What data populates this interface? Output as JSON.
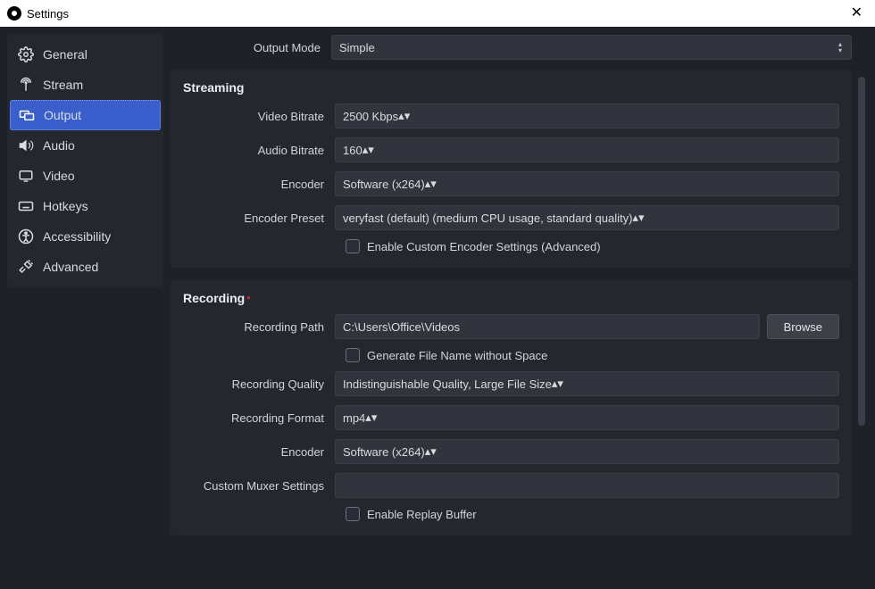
{
  "titlebar": {
    "title": "Settings"
  },
  "sidebar": {
    "items": [
      {
        "label": "General"
      },
      {
        "label": "Stream"
      },
      {
        "label": "Output"
      },
      {
        "label": "Audio"
      },
      {
        "label": "Video"
      },
      {
        "label": "Hotkeys"
      },
      {
        "label": "Accessibility"
      },
      {
        "label": "Advanced"
      }
    ]
  },
  "top": {
    "output_mode_label": "Output Mode",
    "output_mode_value": "Simple"
  },
  "streaming": {
    "title": "Streaming",
    "video_bitrate_label": "Video Bitrate",
    "video_bitrate_value": "2500 Kbps",
    "audio_bitrate_label": "Audio Bitrate",
    "audio_bitrate_value": "160",
    "encoder_label": "Encoder",
    "encoder_value": "Software (x264)",
    "encoder_preset_label": "Encoder Preset",
    "encoder_preset_value": "veryfast (default) (medium CPU usage, standard quality)",
    "enable_custom_label": "Enable Custom Encoder Settings (Advanced)"
  },
  "recording": {
    "title": "Recording",
    "path_label": "Recording Path",
    "path_value": "C:\\Users\\Office\\Videos",
    "browse_label": "Browse",
    "gen_filename_label": "Generate File Name without Space",
    "quality_label": "Recording Quality",
    "quality_value": "Indistinguishable Quality, Large File Size",
    "format_label": "Recording Format",
    "format_value": "mp4",
    "encoder_label": "Encoder",
    "encoder_value": "Software (x264)",
    "muxer_label": "Custom Muxer Settings",
    "muxer_value": "",
    "replay_label": "Enable Replay Buffer"
  }
}
